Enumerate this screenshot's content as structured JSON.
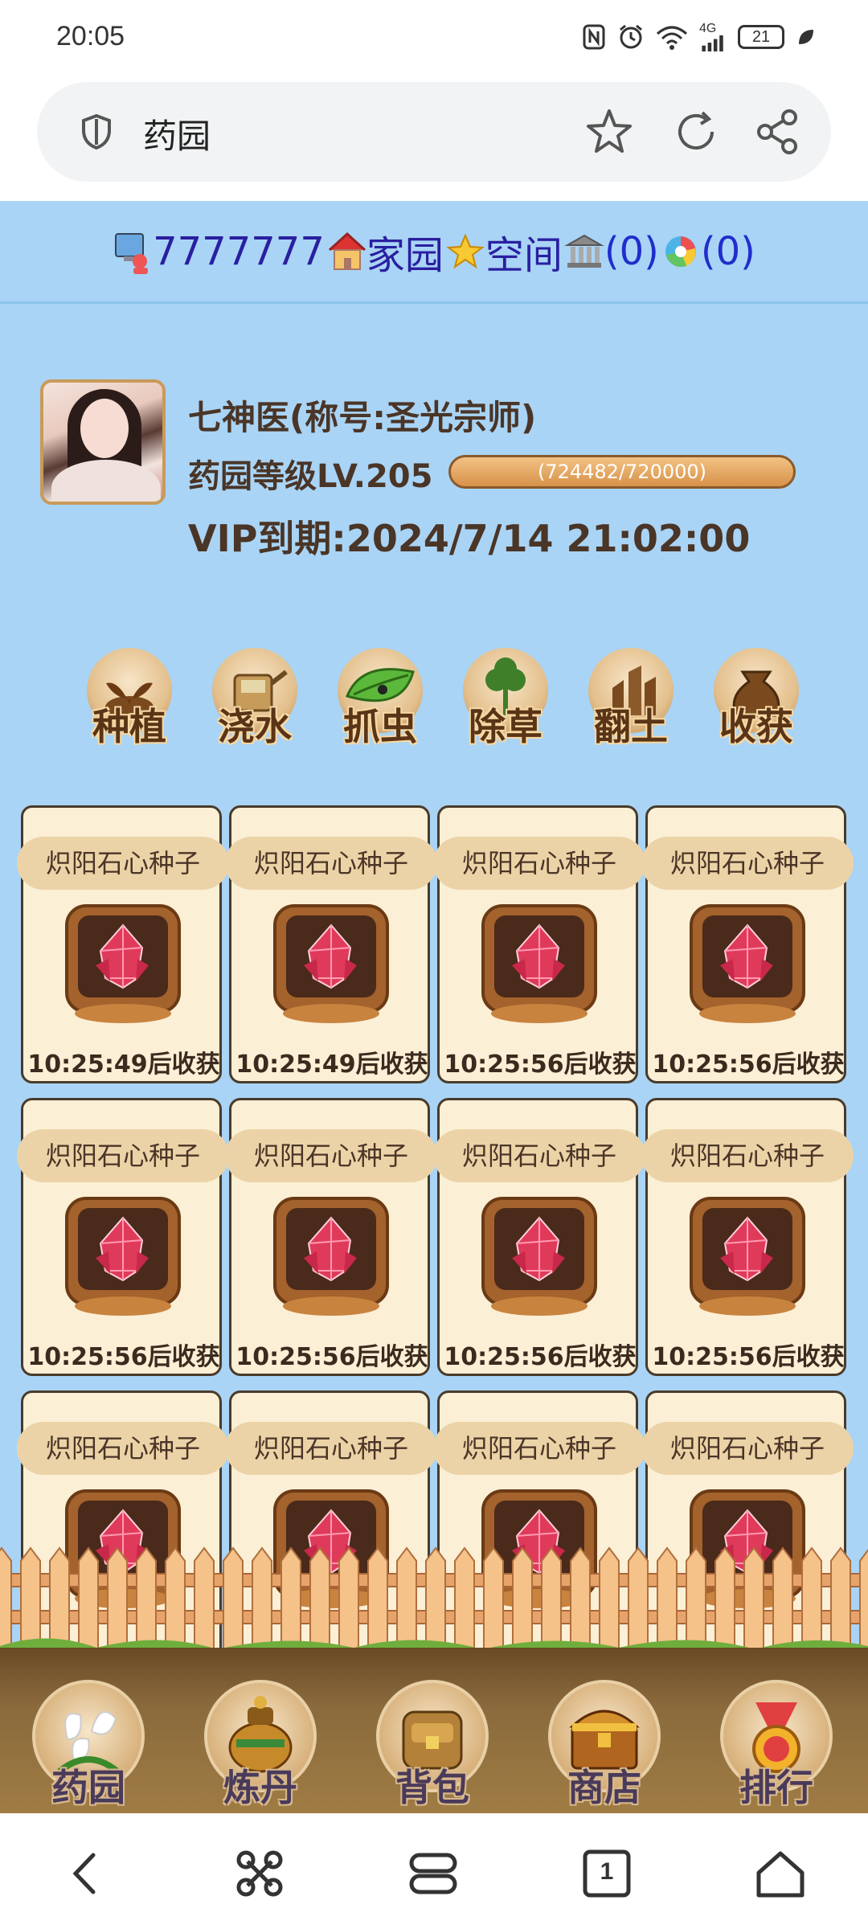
{
  "status_bar": {
    "time": "20:05",
    "battery": "21",
    "network": "4G"
  },
  "browser": {
    "page_title": "药园",
    "icons": [
      "shield-icon",
      "star-icon",
      "refresh-icon",
      "share-icon"
    ]
  },
  "top_nav": {
    "user_id": "7777777",
    "home_label": "家园",
    "space_label": "空间",
    "bank_count": "(0)",
    "lottery_count": "(0)"
  },
  "profile": {
    "name": "七神医(称号:圣光宗师)",
    "level": "药园等级LV.205",
    "exp": "(724482/720000)",
    "vip": "VIP到期:2024/7/14 21:02:00"
  },
  "actions": [
    {
      "label": "种植",
      "icon": "sprout-icon"
    },
    {
      "label": "浇水",
      "icon": "watering-can-icon"
    },
    {
      "label": "抓虫",
      "icon": "bug-leaf-icon"
    },
    {
      "label": "除草",
      "icon": "weed-icon"
    },
    {
      "label": "翻土",
      "icon": "shovel-icon"
    },
    {
      "label": "收获",
      "icon": "harvest-bag-icon"
    }
  ],
  "plots": [
    {
      "seed": "炽阳石心种子",
      "timer": "10:25:49后收获"
    },
    {
      "seed": "炽阳石心种子",
      "timer": "10:25:49后收获"
    },
    {
      "seed": "炽阳石心种子",
      "timer": "10:25:56后收获"
    },
    {
      "seed": "炽阳石心种子",
      "timer": "10:25:56后收获"
    },
    {
      "seed": "炽阳石心种子",
      "timer": "10:25:56后收获"
    },
    {
      "seed": "炽阳石心种子",
      "timer": "10:25:56后收获"
    },
    {
      "seed": "炽阳石心种子",
      "timer": "10:25:56后收获"
    },
    {
      "seed": "炽阳石心种子",
      "timer": "10:25:56后收获"
    },
    {
      "seed": "炽阳石心种子",
      "timer": ""
    },
    {
      "seed": "炽阳石心种子",
      "timer": ""
    },
    {
      "seed": "炽阳石心种子",
      "timer": ""
    },
    {
      "seed": "炽阳石心种子",
      "timer": ""
    }
  ],
  "bottom_nav": [
    {
      "label": "药园",
      "icon": "lily-flower-icon"
    },
    {
      "label": "炼丹",
      "icon": "alchemy-cauldron-icon"
    },
    {
      "label": "背包",
      "icon": "backpack-icon"
    },
    {
      "label": "商店",
      "icon": "treasure-chest-icon"
    },
    {
      "label": "排行",
      "icon": "ranking-medal-icon"
    }
  ],
  "system_nav": {
    "tab_count": "1",
    "icons": [
      "back-icon",
      "shortcuts-icon",
      "tabs-menu-icon",
      "tab-count-icon",
      "home-icon"
    ]
  }
}
